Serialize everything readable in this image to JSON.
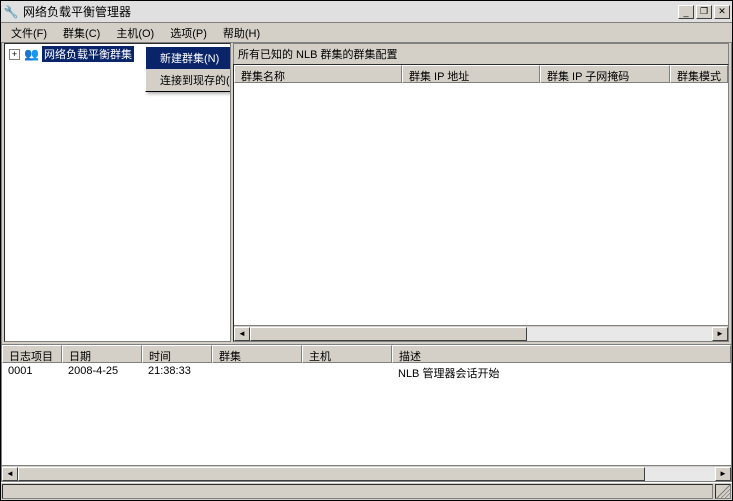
{
  "window": {
    "title": "网络负载平衡管理器",
    "icon": "🔧"
  },
  "titlebar_buttons": {
    "min": "_",
    "restore": "❐",
    "close": "✕"
  },
  "menu": {
    "file": "文件(F)",
    "clusters": "群集(C)",
    "hosts": "主机(O)",
    "options": "选项(P)",
    "help": "帮助(H)"
  },
  "tree": {
    "root_label": "网络负载平衡群集",
    "expand_symbol": "+"
  },
  "context_menu": {
    "new_cluster": "新建群集(N)",
    "connect_existing": "连接到现存的(C)"
  },
  "right": {
    "header": "所有已知的 NLB 群集的群集配置",
    "cols": {
      "name": "群集名称",
      "ip": "群集 IP 地址",
      "mask": "群集 IP 子网掩码",
      "mode": "群集模式"
    }
  },
  "log": {
    "cols": {
      "entry": "日志项目",
      "date": "日期",
      "time": "时间",
      "cluster": "群集",
      "host": "主机",
      "desc": "描述"
    },
    "rows": [
      {
        "entry": "0001",
        "date": "2008-4-25",
        "time": "21:38:33",
        "cluster": "",
        "host": "",
        "desc": "NLB 管理器会话开始"
      }
    ]
  }
}
